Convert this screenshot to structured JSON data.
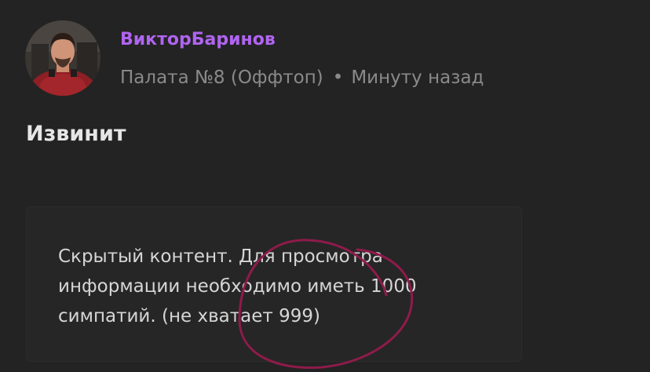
{
  "post": {
    "author": "ВикторБаринов",
    "forum": "Палата №8 (Оффтоп)",
    "separator": "•",
    "time": "Минуту назад",
    "title": "Извинит",
    "hidden_content": "Скрытый контент. Для просмотра информации необходимо иметь 1000 симпатий. (не хватает 999)"
  },
  "colors": {
    "background": "#232323",
    "author": "#b064f0",
    "meta": "#8a8a8a",
    "title": "#e6e6e6",
    "text": "#d6d6d6",
    "circle_mark": "#8e1b4a"
  }
}
